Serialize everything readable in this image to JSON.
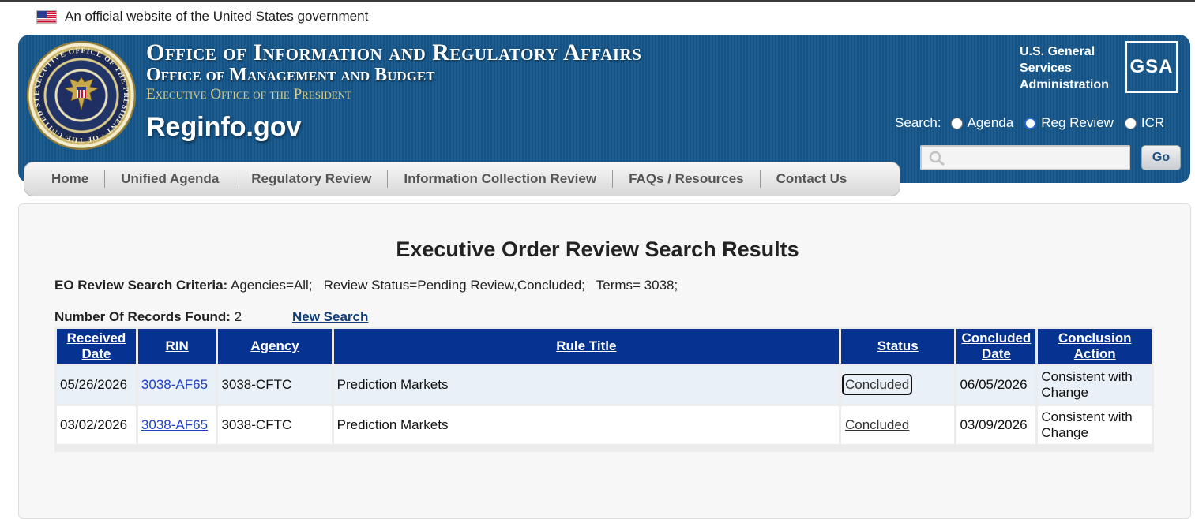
{
  "banner": {
    "text": "An official website of the United States government"
  },
  "header": {
    "line1": "Office of Information and Regulatory Affairs",
    "line2": "Office of Management and Budget",
    "line3": "Executive Office of the President",
    "site": "Reginfo.gov",
    "seal_text": "EXECUTIVE OFFICE OF THE PRESIDENT · OF THE UNITED STATES",
    "gsa_label": [
      "U.S. General",
      "Services",
      "Administration"
    ],
    "gsa_logo": "GSA"
  },
  "search": {
    "label": "Search:",
    "options": [
      {
        "label": "Agenda",
        "selected": false
      },
      {
        "label": "Reg Review",
        "selected": true
      },
      {
        "label": "ICR",
        "selected": false
      }
    ],
    "value": "",
    "go_label": "Go"
  },
  "nav": [
    "Home",
    "Unified Agenda",
    "Regulatory Review",
    "Information Collection Review",
    "FAQs / Resources",
    "Contact Us"
  ],
  "main": {
    "title": "Executive Order Review Search Results",
    "criteria_label": "EO Review Search Criteria:",
    "criteria_value": " Agencies=All;   Review Status=Pending Review,Concluded;   Terms= 3038;",
    "records_label": "Number Of Records Found:",
    "records_count": "2",
    "new_search": "New Search"
  },
  "table": {
    "headers": [
      [
        "Received",
        "Date"
      ],
      [
        "RIN"
      ],
      [
        "Agency"
      ],
      [
        "Rule Title"
      ],
      [
        "Status"
      ],
      [
        "Concluded",
        "Date"
      ],
      [
        "Conclusion",
        "Action"
      ]
    ],
    "rows": [
      {
        "received": "05/26/2026",
        "rin": "3038-AF65",
        "agency": "3038-CFTC",
        "title": "Prediction Markets",
        "status": "Concluded",
        "concluded": "06/05/2026",
        "action": [
          "Consistent with",
          "Change"
        ]
      },
      {
        "received": "03/02/2026",
        "rin": "3038-AF65",
        "agency": "3038-CFTC",
        "title": "Prediction Markets",
        "status": "Concluded",
        "concluded": "03/09/2026",
        "action": [
          "Consistent with",
          "Change"
        ]
      }
    ]
  },
  "colors": {
    "header_blue": "#1c5c8f",
    "table_header": "#063291",
    "link": "#1f3fc7"
  }
}
